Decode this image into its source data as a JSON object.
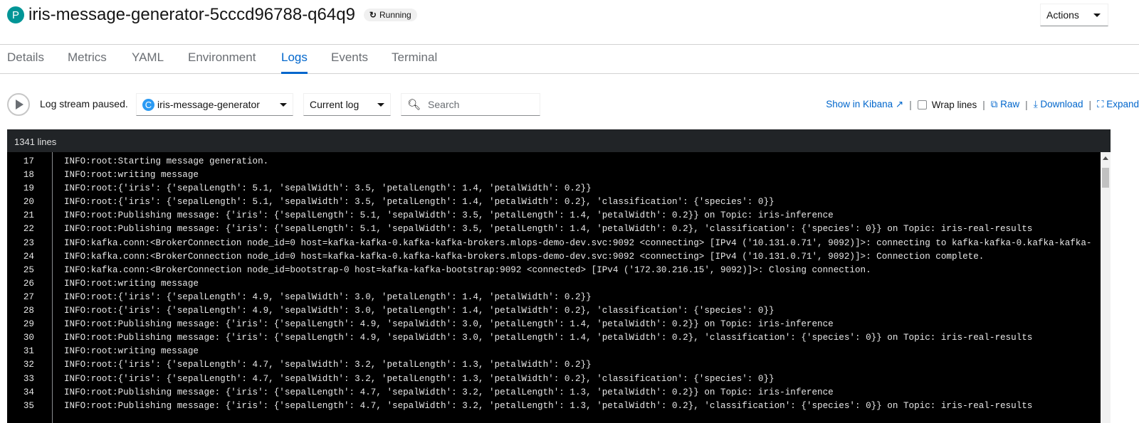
{
  "header": {
    "resource_badge": "P",
    "title": "iris-message-generator-5cccd96788-q64q9",
    "status": "Running",
    "actions_label": "Actions"
  },
  "tabs": [
    {
      "label": "Details"
    },
    {
      "label": "Metrics"
    },
    {
      "label": "YAML"
    },
    {
      "label": "Environment"
    },
    {
      "label": "Logs",
      "active": true
    },
    {
      "label": "Events"
    },
    {
      "label": "Terminal"
    }
  ],
  "toolbar": {
    "stream_status": "Log stream paused.",
    "container_badge": "C",
    "container": "iris-message-generator",
    "log_type": "Current log",
    "search_placeholder": "Search",
    "kibana": "Show in Kibana",
    "wrap_lines": "Wrap lines",
    "wrap_checked": false,
    "raw": "Raw",
    "download": "Download",
    "expand": "Expand"
  },
  "log": {
    "line_count": "1341 lines",
    "lines": [
      {
        "n": "17",
        "t": "INFO:root:Starting message generation."
      },
      {
        "n": "18",
        "t": "INFO:root:writing message"
      },
      {
        "n": "19",
        "t": "INFO:root:{'iris': {'sepalLength': 5.1, 'sepalWidth': 3.5, 'petalLength': 1.4, 'petalWidth': 0.2}}"
      },
      {
        "n": "20",
        "t": "INFO:root:{'iris': {'sepalLength': 5.1, 'sepalWidth': 3.5, 'petalLength': 1.4, 'petalWidth': 0.2}, 'classification': {'species': 0}}"
      },
      {
        "n": "21",
        "t": "INFO:root:Publishing message: {'iris': {'sepalLength': 5.1, 'sepalWidth': 3.5, 'petalLength': 1.4, 'petalWidth': 0.2}} on Topic: iris-inference"
      },
      {
        "n": "22",
        "t": "INFO:root:Publishing message: {'iris': {'sepalLength': 5.1, 'sepalWidth': 3.5, 'petalLength': 1.4, 'petalWidth': 0.2}, 'classification': {'species': 0}} on Topic: iris-real-results"
      },
      {
        "n": "23",
        "t": "INFO:kafka.conn:<BrokerConnection node_id=0 host=kafka-kafka-0.kafka-kafka-brokers.mlops-demo-dev.svc:9092 <connecting> [IPv4 ('10.131.0.71', 9092)]>: connecting to kafka-kafka-0.kafka-kafka-"
      },
      {
        "n": "24",
        "t": "INFO:kafka.conn:<BrokerConnection node_id=0 host=kafka-kafka-0.kafka-kafka-brokers.mlops-demo-dev.svc:9092 <connecting> [IPv4 ('10.131.0.71', 9092)]>: Connection complete."
      },
      {
        "n": "25",
        "t": "INFO:kafka.conn:<BrokerConnection node_id=bootstrap-0 host=kafka-kafka-bootstrap:9092 <connected> [IPv4 ('172.30.216.15', 9092)]>: Closing connection."
      },
      {
        "n": "26",
        "t": "INFO:root:writing message"
      },
      {
        "n": "27",
        "t": "INFO:root:{'iris': {'sepalLength': 4.9, 'sepalWidth': 3.0, 'petalLength': 1.4, 'petalWidth': 0.2}}"
      },
      {
        "n": "28",
        "t": "INFO:root:{'iris': {'sepalLength': 4.9, 'sepalWidth': 3.0, 'petalLength': 1.4, 'petalWidth': 0.2}, 'classification': {'species': 0}}"
      },
      {
        "n": "29",
        "t": "INFO:root:Publishing message: {'iris': {'sepalLength': 4.9, 'sepalWidth': 3.0, 'petalLength': 1.4, 'petalWidth': 0.2}} on Topic: iris-inference"
      },
      {
        "n": "30",
        "t": "INFO:root:Publishing message: {'iris': {'sepalLength': 4.9, 'sepalWidth': 3.0, 'petalLength': 1.4, 'petalWidth': 0.2}, 'classification': {'species': 0}} on Topic: iris-real-results"
      },
      {
        "n": "31",
        "t": "INFO:root:writing message"
      },
      {
        "n": "32",
        "t": "INFO:root:{'iris': {'sepalLength': 4.7, 'sepalWidth': 3.2, 'petalLength': 1.3, 'petalWidth': 0.2}}"
      },
      {
        "n": "33",
        "t": "INFO:root:{'iris': {'sepalLength': 4.7, 'sepalWidth': 3.2, 'petalLength': 1.3, 'petalWidth': 0.2}, 'classification': {'species': 0}}"
      },
      {
        "n": "34",
        "t": "INFO:root:Publishing message: {'iris': {'sepalLength': 4.7, 'sepalWidth': 3.2, 'petalLength': 1.3, 'petalWidth': 0.2}} on Topic: iris-inference"
      },
      {
        "n": "35",
        "t": "INFO:root:Publishing message: {'iris': {'sepalLength': 4.7, 'sepalWidth': 3.2, 'petalLength': 1.3, 'petalWidth': 0.2}, 'classification': {'species': 0}} on Topic: iris-real-results"
      }
    ]
  },
  "colors": {
    "accent": "#0066cc",
    "pod_badge": "#009596",
    "container_badge": "#2b9af3",
    "log_bg": "#000000",
    "log_header_bg": "#212427"
  }
}
